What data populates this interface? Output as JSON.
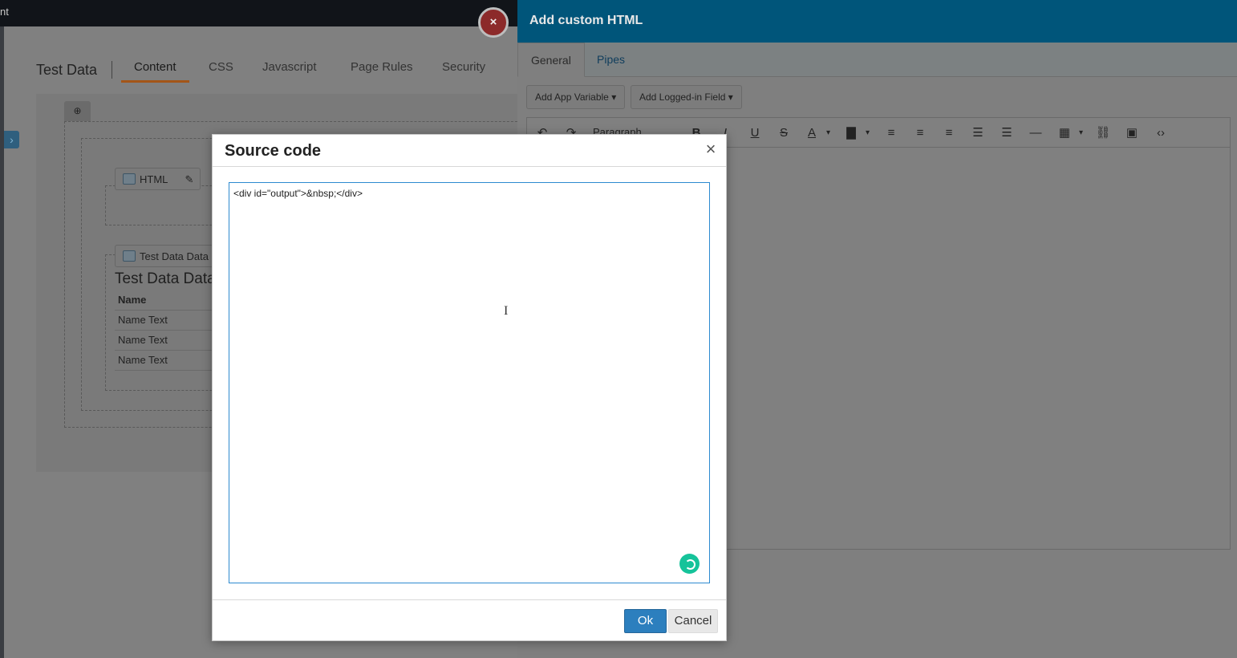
{
  "topbar": {
    "fragment": "nt"
  },
  "page": {
    "title": "Test Data",
    "tabs": [
      {
        "label": "Content"
      },
      {
        "label": "CSS"
      },
      {
        "label": "Javascript"
      },
      {
        "label": "Page Rules"
      },
      {
        "label": "Security"
      }
    ]
  },
  "canvas": {
    "html_chip": "HTML",
    "table_chip": "Test Data Data",
    "table_title": "Test Data Data",
    "table_header": "Name",
    "table_rows": [
      "Name Text",
      "Name Text",
      "Name Text"
    ]
  },
  "panel": {
    "title": "Add custom HTML",
    "tabs": [
      {
        "label": "General"
      },
      {
        "label": "Pipes"
      }
    ],
    "buttons": {
      "app_variable": "Add App Variable",
      "logged_in_field": "Add Logged-in Field"
    },
    "format_select": "Paragraph"
  },
  "modal": {
    "title": "Source code",
    "source": "<div id=\"output\">&nbsp;</div>",
    "ok_label": "Ok",
    "cancel_label": "Cancel"
  },
  "colors": {
    "panel_header": "#00557a",
    "ok_button": "#2c7fbe",
    "active_tab_underline": "#a35518",
    "grammar_badge": "#15c39a"
  }
}
